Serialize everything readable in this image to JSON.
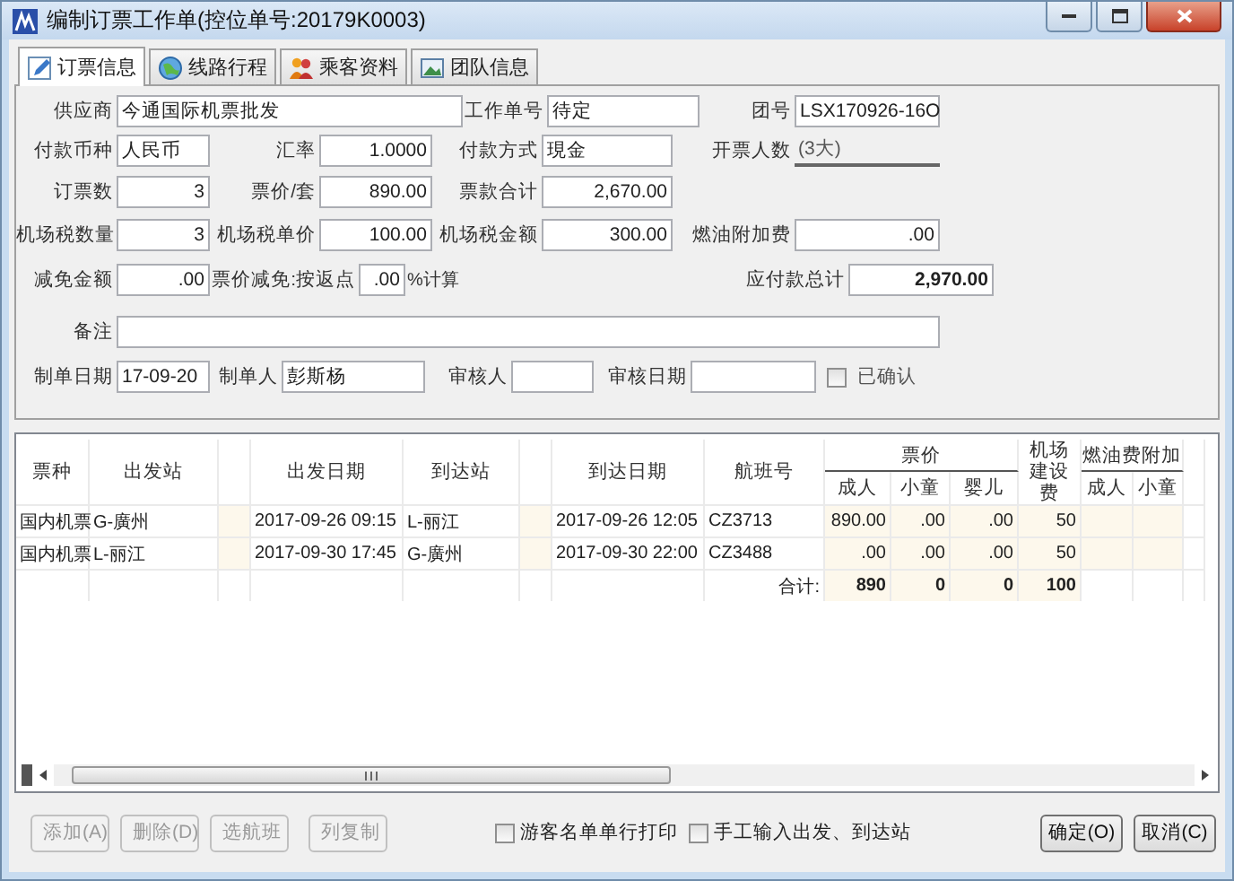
{
  "window": {
    "title": "编制订票工作单(控位单号:20179K0003)"
  },
  "tabs": [
    {
      "label": "订票信息",
      "selected": true
    },
    {
      "label": "线路行程",
      "selected": false
    },
    {
      "label": "乘客资料",
      "selected": false
    },
    {
      "label": "团队信息",
      "selected": false
    }
  ],
  "form": {
    "rows": [
      {
        "fields": [
          {
            "label": "供应商",
            "value": "今通国际机票批发",
            "kind": "text"
          },
          {
            "label": "工作单号",
            "value": "待定",
            "kind": "text"
          },
          {
            "label": "团号",
            "value": "LSX170926-16O",
            "kind": "text"
          }
        ]
      },
      {
        "fields": [
          {
            "label": "付款币种",
            "value": "人民币",
            "kind": "text"
          },
          {
            "label": "汇率",
            "value": "1.0000",
            "kind": "number"
          },
          {
            "label": "付款方式",
            "value": "現金",
            "kind": "text"
          },
          {
            "label": "开票人数",
            "value": "(3大)",
            "kind": "readout"
          }
        ]
      },
      {
        "fields": [
          {
            "label": "订票数",
            "value": "3",
            "kind": "number"
          },
          {
            "label": "票价/套",
            "value": "890.00",
            "kind": "number"
          },
          {
            "label": "票款合计",
            "value": "2,670.00",
            "kind": "number"
          }
        ]
      },
      {
        "fields": [
          {
            "label": "机场税数量",
            "value": "3",
            "kind": "number"
          },
          {
            "label": "机场税单价",
            "value": "100.00",
            "kind": "number"
          },
          {
            "label": "机场税金额",
            "value": "300.00",
            "kind": "number"
          },
          {
            "label": "燃油附加费",
            "value": ".00",
            "kind": "number"
          }
        ]
      },
      {
        "fields": [
          {
            "label": "减免金额",
            "value": ".00",
            "kind": "number"
          },
          {
            "label": "票价减免:按返点",
            "value": ".00",
            "kind": "number",
            "suffix": "%计算"
          },
          {
            "label": "应付款总计",
            "value": "2,970.00",
            "kind": "total"
          }
        ]
      },
      {
        "fields": [
          {
            "label": "备注",
            "kind": "text"
          }
        ]
      },
      {
        "fields": [
          {
            "label": "制单日期",
            "value": "17-09-20",
            "kind": "text"
          },
          {
            "label": "制单人",
            "value": "彭斯杨",
            "kind": "text"
          },
          {
            "label": "审核人",
            "kind": "text"
          },
          {
            "label": "审核日期",
            "kind": "text"
          },
          {
            "label": "已确认",
            "kind": "checkbox",
            "checked": false
          }
        ]
      }
    ]
  },
  "table": {
    "columns": [
      {
        "label": "票种"
      },
      {
        "label": "出发站"
      },
      {},
      {
        "label": "出发日期"
      },
      {
        "label": "到达站"
      },
      {},
      {
        "label": "到达日期"
      },
      {
        "label": "航班号"
      },
      {
        "label": "票价",
        "children": [
          {
            "label": "成人"
          },
          {
            "label": "小童"
          },
          {
            "label": "婴儿"
          }
        ]
      },
      {
        "label": "机场建设费"
      },
      {
        "label": "燃油费附加",
        "children": [
          {
            "label": "成人"
          },
          {
            "label": "小童"
          }
        ]
      },
      {}
    ],
    "rows": [
      {
        "cells": [
          "国内机票",
          "G-廣州",
          "",
          "2017-09-26 09:15",
          "L-丽江",
          "",
          "2017-09-26 12:05",
          "CZ3713",
          "890.00",
          ".00",
          ".00",
          "50",
          "",
          "",
          ""
        ]
      },
      {
        "cells": [
          "国内机票",
          "L-丽江",
          "",
          "2017-09-30 17:45",
          "G-廣州",
          "",
          "2017-09-30 22:00",
          "CZ3488",
          ".00",
          ".00",
          ".00",
          "50",
          "",
          "",
          ""
        ]
      }
    ],
    "totals": {
      "cells": [
        "",
        "",
        "",
        "",
        "",
        "",
        "",
        "合计:",
        "890",
        "0",
        "0",
        "100",
        "",
        "",
        ""
      ]
    }
  },
  "left_buttons": [
    {
      "label": "添加(A)",
      "disabled": true
    },
    {
      "label": "删除(D)",
      "disabled": true
    },
    {
      "label": "选航班",
      "disabled": true
    },
    {
      "label": "列复制",
      "disabled": true
    }
  ],
  "options": [
    {
      "label": "游客名单单行打印",
      "checked": false
    },
    {
      "label": "手工输入出发、到达站",
      "checked": false
    }
  ],
  "right_buttons": [
    {
      "label": "确定(O)",
      "disabled": false
    },
    {
      "label": "取消(C)",
      "disabled": false
    }
  ]
}
